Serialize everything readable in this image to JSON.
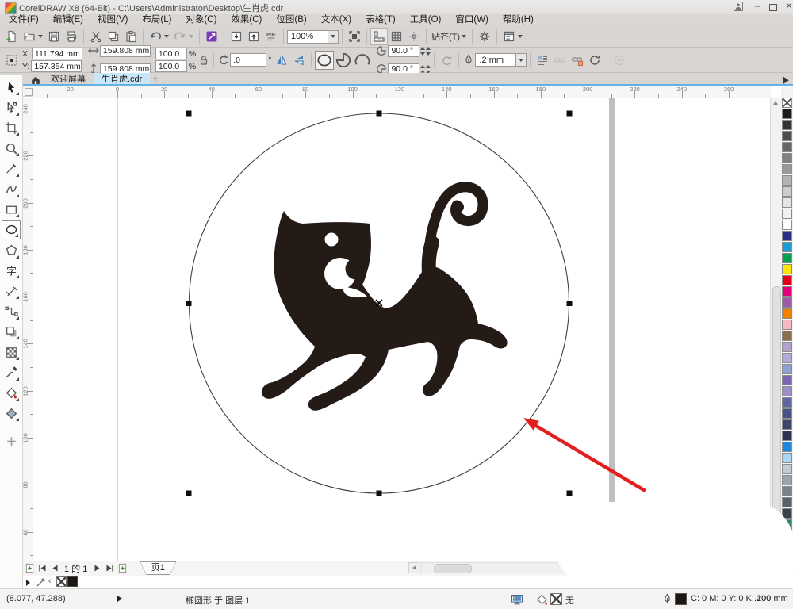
{
  "window": {
    "title": "CorelDRAW X8 (64-Bit) - C:\\Users\\Administrator\\Desktop\\生肖虎.cdr",
    "minimize": "–",
    "close": "✕"
  },
  "menu": {
    "items": [
      "文件(F)",
      "编辑(E)",
      "视图(V)",
      "布局(L)",
      "对象(C)",
      "效果(C)",
      "位图(B)",
      "文本(X)",
      "表格(T)",
      "工具(O)",
      "窗口(W)",
      "帮助(H)"
    ]
  },
  "toolbar": {
    "zoom_value": "100%",
    "snap_label": "贴齐(T)"
  },
  "property_bar": {
    "x_label": "X:",
    "x_value": "111.794 mm",
    "y_label": "Y:",
    "y_value": "157.354 mm",
    "width_value": "159.808 mm",
    "height_value": "159.808 mm",
    "scale_h": "100.0",
    "scale_v": "100.0",
    "percent": "%",
    "rotation_value": ".0",
    "degree": "°",
    "start_angle": "90.0 °",
    "end_angle": "90.0 °",
    "outline_width": ".2 mm"
  },
  "tabs": {
    "welcome": "欢迎屏幕",
    "document": "生肖虎.cdr",
    "new_tab": "+"
  },
  "rulers": {
    "h_labels": [
      -20,
      0,
      20,
      40,
      60,
      80,
      100,
      120,
      140,
      160,
      180,
      200,
      220,
      240,
      260
    ],
    "v_labels": [
      240,
      220,
      200,
      180,
      160,
      140,
      120,
      100,
      80,
      60
    ]
  },
  "toolbox": {
    "tools": [
      {
        "name": "pick-tool",
        "icon": "pick"
      },
      {
        "name": "shape-tool",
        "icon": "shape"
      },
      {
        "name": "crop-tool",
        "icon": "crop"
      },
      {
        "name": "zoom-tool",
        "icon": "zoomt"
      },
      {
        "name": "freehand-tool",
        "icon": "freehand"
      },
      {
        "name": "bspline-tool",
        "icon": "bspline"
      },
      {
        "name": "rectangle-tool",
        "icon": "rect"
      },
      {
        "name": "ellipse-tool",
        "icon": "ellipse",
        "active": true
      },
      {
        "name": "polygon-tool",
        "icon": "polygon"
      },
      {
        "name": "text-tool",
        "icon": "text"
      },
      {
        "name": "dimension-tool",
        "icon": "dimension"
      },
      {
        "name": "connector-tool",
        "icon": "connector"
      },
      {
        "name": "drop-shadow-tool",
        "icon": "shadow"
      },
      {
        "name": "transparency-tool",
        "icon": "transp"
      },
      {
        "name": "eyedropper-tool",
        "icon": "eyedrop"
      },
      {
        "name": "smart-fill-tool",
        "icon": "smartfill"
      },
      {
        "name": "interactive-fill-tool",
        "icon": "fill"
      },
      {
        "name": "more-tools",
        "icon": "plus"
      }
    ]
  },
  "palette": {
    "colors": [
      "none",
      "#1a1a18",
      "#333331",
      "#4d4d4b",
      "#666664",
      "#80807e",
      "#999997",
      "#b3b3b1",
      "#cccccb",
      "#e4e4e3",
      "#f2f2f1",
      "#ffffff",
      "#2b2e83",
      "#1d9bd7",
      "#00a04e",
      "#ffe600",
      "#e2001a",
      "#e2007a",
      "#9c5ba4",
      "#ef8200",
      "#f2b8c6",
      "#8a6c4e",
      "#b0a3cd",
      "#b6abd8",
      "#8e9fd0",
      "#7a68b0",
      "#9a90c4",
      "#5f66a0",
      "#485384",
      "#3b4469",
      "#2d3353",
      "#1f86dd",
      "#abd7f5",
      "#c3ccd3",
      "#99a4ac",
      "#78838b",
      "#58636b",
      "#38434b",
      "#2f8a64",
      "#64a88c"
    ]
  },
  "page_bar": {
    "nav_text": "1 的 1",
    "page_tab": "页1"
  },
  "status_bar": {
    "coords": "(8.077, 47.288)",
    "object_info": "椭圆形 于 图层 1",
    "fill_none": "无",
    "outline_cmyk": "C: 0 M: 0 Y: 0 K: 100",
    "outline_width": ".200 mm"
  },
  "canvas": {
    "accent_red": "#e41e1e",
    "cat_color": "#241b16"
  }
}
